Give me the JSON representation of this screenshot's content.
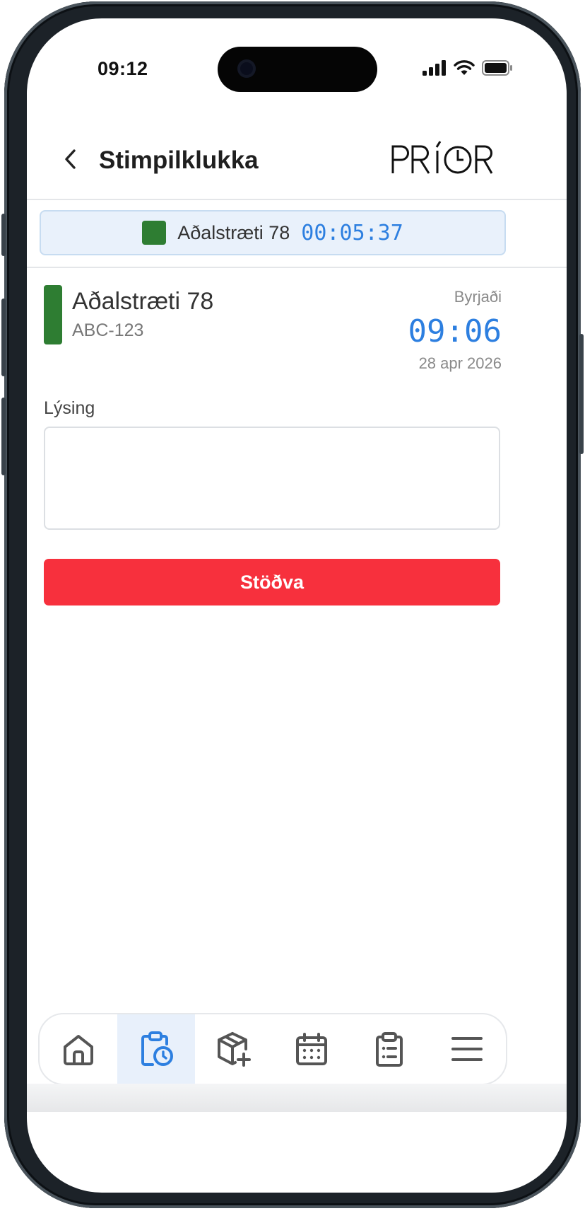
{
  "status_bar": {
    "time": "09:12",
    "icons": [
      "cellular-signal-icon",
      "wifi-icon",
      "battery-icon"
    ]
  },
  "header": {
    "title": "Stimpilklukka",
    "back_icon": "chevron-left-icon",
    "logo_text": "PRÍOR"
  },
  "active_timer": {
    "location": "Aðalstræti 78",
    "elapsed": "00:05:37",
    "color": "#2e7d32"
  },
  "job": {
    "name": "Aðalstræti 78",
    "code": "ABC-123",
    "started_label": "Byrjaði",
    "start_time": "09:06",
    "start_date": "28 apr 2026",
    "color": "#2e7d32"
  },
  "description": {
    "label": "Lýsing",
    "value": "",
    "placeholder": ""
  },
  "stop_button": {
    "label": "Stöðva",
    "color": "#f7303d"
  },
  "bottom_nav": {
    "active_index": 1,
    "items": [
      {
        "icon": "home-icon"
      },
      {
        "icon": "clipboard-clock-icon"
      },
      {
        "icon": "package-add-icon"
      },
      {
        "icon": "calendar-icon"
      },
      {
        "icon": "clipboard-list-icon"
      },
      {
        "icon": "menu-icon"
      }
    ]
  },
  "colors": {
    "accent_blue": "#2d7fe0",
    "active_nav_bg": "#e8f0fb"
  }
}
